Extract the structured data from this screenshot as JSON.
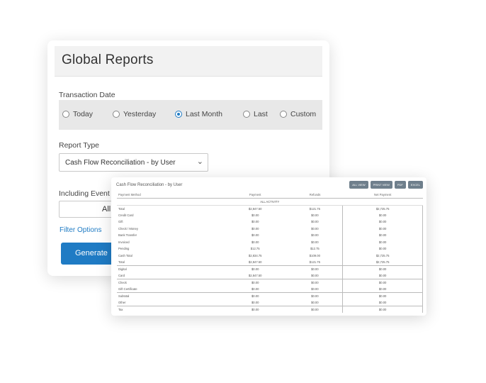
{
  "global_reports": {
    "title": "Global Reports",
    "transaction_date_label": "Transaction Date",
    "radios": [
      {
        "label": "Today",
        "checked": false
      },
      {
        "label": "Yesterday",
        "checked": false
      },
      {
        "label": "Last Month",
        "checked": true
      },
      {
        "label": "Last",
        "checked": false
      },
      {
        "label": "Custom",
        "checked": false
      }
    ],
    "report_type_label": "Report Type",
    "report_type_value": "Cash Flow Reconciliation - by User",
    "including_event_label": "Including Event",
    "including_event_value": "All",
    "filter_options_label": "Filter Options",
    "generate_label": "Generate",
    "accent_color": "#1f7bc4"
  },
  "report": {
    "title": "Cash Flow Reconciliation - by User",
    "buttons": [
      "ALL VIEW",
      "PRINT VIEW",
      "PDF",
      "EXCEL"
    ],
    "columns": [
      "Payment Method",
      "Payment",
      "Refunds",
      "Net Payment"
    ],
    "all_activity_label": "ALL ACTIVITY",
    "rows": [
      {
        "label": "Total",
        "payment": "$2,847.50",
        "refunds": "$121.75",
        "net": "$2,725.75",
        "sep": false
      },
      {
        "label": "Credit Card",
        "payment": "$0.00",
        "refunds": "$0.00",
        "net": "$0.00",
        "sep": false
      },
      {
        "label": "Gift",
        "payment": "$0.00",
        "refunds": "$0.00",
        "net": "$0.00",
        "sep": false
      },
      {
        "label": "Check / Money",
        "payment": "$0.00",
        "refunds": "$0.00",
        "net": "$0.00",
        "sep": false
      },
      {
        "label": "Bank Transfer",
        "payment": "$0.00",
        "refunds": "$0.00",
        "net": "$0.00",
        "sep": false
      },
      {
        "label": "Invoiced",
        "payment": "$0.00",
        "refunds": "$0.00",
        "net": "$0.00",
        "sep": false
      },
      {
        "label": "Pending",
        "payment": "$12.75",
        "refunds": "$12.75",
        "net": "$0.00",
        "sep": false
      },
      {
        "label": "Cash Total",
        "payment": "$2,834.75",
        "refunds": "$109.00",
        "net": "$2,725.75",
        "sep": false
      },
      {
        "label": "Total",
        "payment": "$2,847.50",
        "refunds": "$121.75",
        "net": "$2,725.75",
        "sep": false
      },
      {
        "label": "Digital",
        "payment": "$0.00",
        "refunds": "$0.00",
        "net": "$0.00",
        "sep": true
      },
      {
        "label": "Card",
        "payment": "$2,847.50",
        "refunds": "$0.00",
        "net": "$0.00",
        "sep": false
      },
      {
        "label": "Check",
        "payment": "$0.00",
        "refunds": "$0.00",
        "net": "$0.00",
        "sep": true
      },
      {
        "label": "Gift Certificate",
        "payment": "$0.00",
        "refunds": "$0.00",
        "net": "$0.00",
        "sep": false
      },
      {
        "label": "Subtotal",
        "payment": "$0.00",
        "refunds": "$0.00",
        "net": "$0.00",
        "sep": true
      },
      {
        "label": "Other",
        "payment": "$0.00",
        "refunds": "$0.00",
        "net": "$0.00",
        "sep": false
      },
      {
        "label": "Tax",
        "payment": "$0.00",
        "refunds": "$0.00",
        "net": "$0.00",
        "sep": true
      }
    ]
  }
}
